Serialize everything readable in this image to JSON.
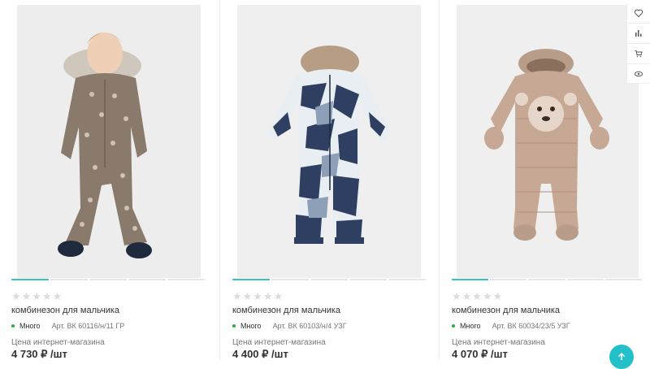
{
  "products": [
    {
      "stars": "★★★★★",
      "title": "комбинезон для мальчика",
      "availability": "Много",
      "article": "Арт. ВК 60116/н/11 ГР",
      "price_label": "Цена интернет-магазина",
      "price": "4 730 ₽ /шт"
    },
    {
      "stars": "★★★★★",
      "title": "комбинезон для мальчика",
      "availability": "Много",
      "article": "Арт. ВК 60103/н/4 УЗГ",
      "price_label": "Цена интернет-магазина",
      "price": "4 400 ₽ /шт"
    },
    {
      "stars": "★★★★★",
      "title": "комбинезон для мальчика",
      "availability": "Много",
      "article": "Арт. ВК 60034/23/5 УЗГ",
      "price_label": "Цена интернет-магазина",
      "price": "4 070 ₽ /шт"
    }
  ],
  "tools": [
    "heart-icon",
    "compare-icon",
    "cart-icon",
    "eye-icon"
  ],
  "colors": {
    "accent": "#39c2c2",
    "in_stock": "#2ab040",
    "up_button": "#23c0c9"
  }
}
